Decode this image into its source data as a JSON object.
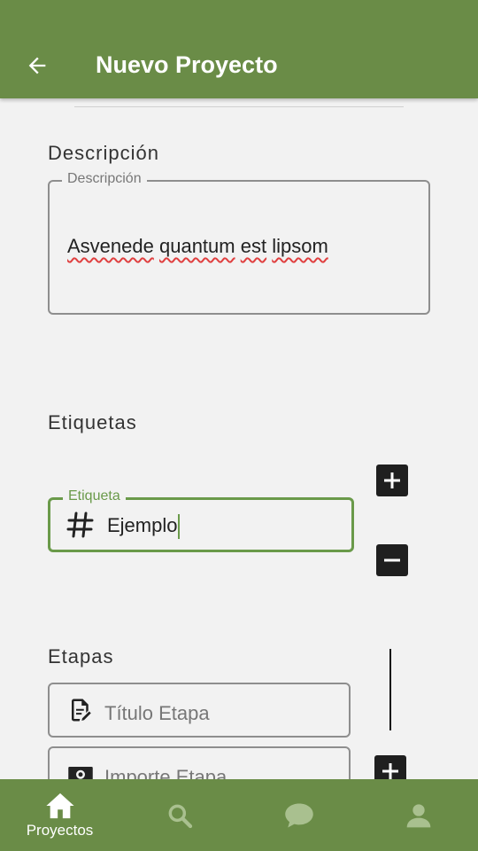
{
  "header": {
    "title": "Nuevo Proyecto",
    "back_icon": "arrow-back-icon"
  },
  "description": {
    "section_title": "Descripción",
    "field_label": "Descripción",
    "words": [
      "Asvenede",
      "quantum",
      "est",
      "lipsom"
    ]
  },
  "tags": {
    "section_title": "Etiquetas",
    "field_label": "Etiqueta",
    "icon": "hash-icon",
    "value": "Ejemplo",
    "add_icon": "plus-icon",
    "remove_icon": "minus-icon"
  },
  "stages": {
    "section_title": "Etapas",
    "title_placeholder": "Título Etapa",
    "amount_placeholder": "Importe Etapa",
    "title_icon": "document-edit-icon",
    "amount_icon": "money-icon",
    "add_icon": "plus-icon"
  },
  "bottom_nav": {
    "items": [
      {
        "label": "Proyectos",
        "icon": "home-icon",
        "active": true
      },
      {
        "label": "",
        "icon": "search-icon",
        "active": false
      },
      {
        "label": "",
        "icon": "chat-icon",
        "active": false
      },
      {
        "label": "",
        "icon": "person-icon",
        "active": false
      }
    ]
  },
  "colors": {
    "primary": "#6a8c47",
    "focus": "#6a9a4a",
    "background": "#f2f2f2",
    "inactive_icon": "#a9c08f"
  }
}
